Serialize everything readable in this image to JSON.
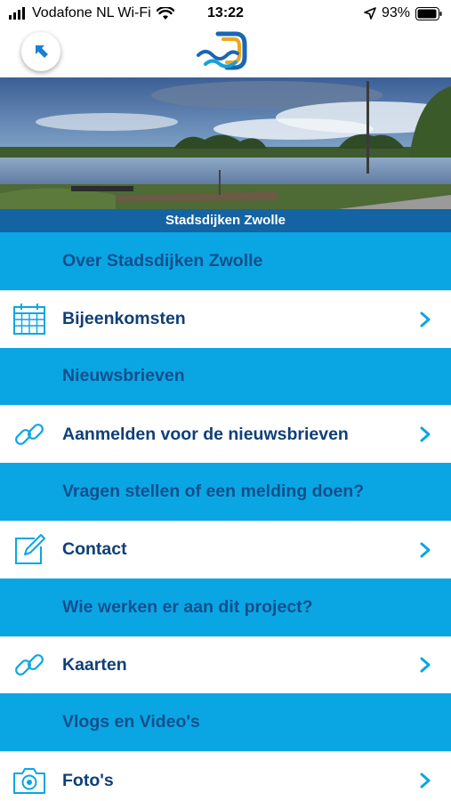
{
  "status_bar": {
    "carrier": "Vodafone NL Wi-Fi",
    "time": "13:22",
    "battery": "93%"
  },
  "header": {
    "back_icon": "arrow-up-left-icon",
    "logo_icon": "stadsdijken-logo"
  },
  "banner": {
    "title": "Stadsdijken Zwolle"
  },
  "menu": {
    "items": [
      {
        "label": "Over Stadsdijken Zwolle",
        "style": "section"
      },
      {
        "label": "Bijeenkomsten",
        "style": "link",
        "icon": "calendar-icon"
      },
      {
        "label": "Nieuwsbrieven",
        "style": "section"
      },
      {
        "label": "Aanmelden voor de nieuwsbrieven",
        "style": "link",
        "icon": "link-icon"
      },
      {
        "label": "Vragen stellen of een melding doen?",
        "style": "section"
      },
      {
        "label": "Contact",
        "style": "link",
        "icon": "edit-icon"
      },
      {
        "label": "Wie werken er aan dit project?",
        "style": "section"
      },
      {
        "label": "Kaarten",
        "style": "link",
        "icon": "link-icon"
      },
      {
        "label": "Vlogs en Video's",
        "style": "section"
      },
      {
        "label": "Foto's",
        "style": "link",
        "icon": "camera-icon"
      }
    ]
  },
  "colors": {
    "section_blue": "#0aa6e4",
    "banner_blue": "#1463a3",
    "label_dark_blue": "#124f8c",
    "icon_blue": "#0aa6e4"
  }
}
